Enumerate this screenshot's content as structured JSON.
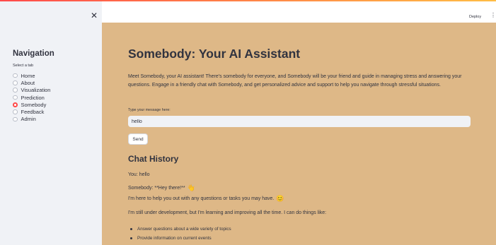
{
  "sidebar": {
    "close_icon": "close-icon",
    "title": "Navigation",
    "select_label": "Select a tab",
    "items": [
      {
        "label": "Home",
        "selected": false
      },
      {
        "label": "About",
        "selected": false
      },
      {
        "label": "Visualization",
        "selected": false
      },
      {
        "label": "Prediction",
        "selected": false
      },
      {
        "label": "Somebody",
        "selected": true
      },
      {
        "label": "Feedback",
        "selected": false
      },
      {
        "label": "Admin",
        "selected": false
      }
    ]
  },
  "header": {
    "deploy_label": "Deploy",
    "menu_icon": "kebab-menu-icon"
  },
  "main": {
    "title": "Somebody: Your AI Assistant",
    "intro": "Meet Somebody, your AI assistant! There's somebody for everyone, and Somebody will be your friend and guide in managing stress and answering your questions. Engage in a friendly chat with Somebody, and get personalized advice and support to help you navigate through stressful situations.",
    "input_label": "Type your message here:",
    "input_value": "hello",
    "send_label": "Send",
    "history_title": "Chat History",
    "chat": {
      "user_line": "You: hello",
      "bot_line": "Somebody: **Hey there!**",
      "bot_line_icon": "waving-hand-icon",
      "line2": "I'm here to help you out with any questions or tasks you may have.",
      "line2_icon": "smiling-face-icon",
      "line3": "I'm still under development, but I'm learning and improving all the time. I can do things like:",
      "bullets": [
        "Answer questions about a wide variety of topics",
        "Provide information on current events"
      ]
    }
  },
  "colors": {
    "accent": "#ff4b4b",
    "main_background": "#deb887",
    "sidebar_background": "#f0f2f6"
  }
}
